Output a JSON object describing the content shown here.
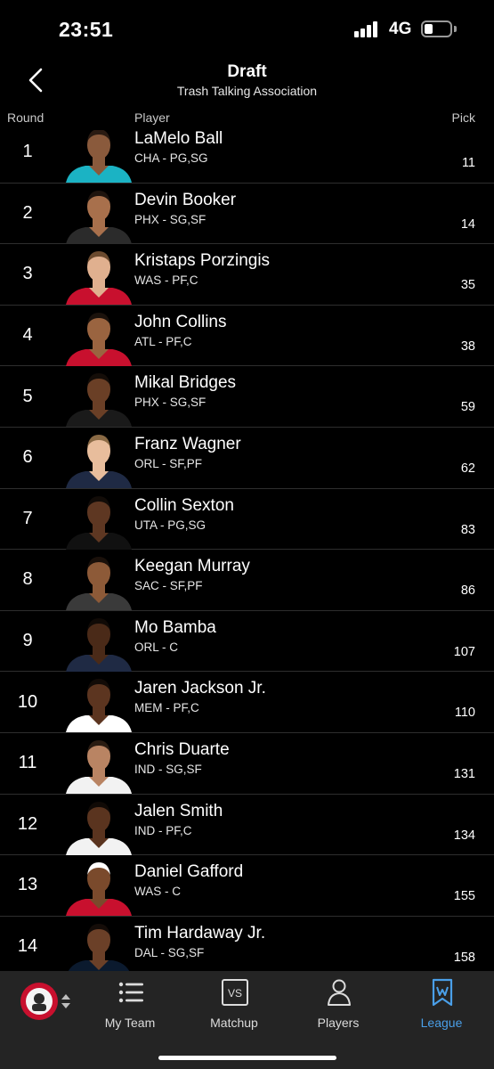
{
  "status": {
    "time": "23:51",
    "network": "4G"
  },
  "header": {
    "title": "Draft",
    "subtitle": "Trash Talking Association"
  },
  "columns": {
    "round": "Round",
    "player": "Player",
    "pick": "Pick"
  },
  "picks": [
    {
      "round": "1",
      "name": "LaMelo Ball",
      "info": "CHA - PG,SG",
      "pick": "11",
      "jersey": "#1bb3c4",
      "skin": "#8a5a3c",
      "hair": "#2a1b12"
    },
    {
      "round": "2",
      "name": "Devin Booker",
      "info": "PHX - SG,SF",
      "pick": "14",
      "jersey": "#2b2b2b",
      "skin": "#a8704c",
      "hair": "#1e140e"
    },
    {
      "round": "3",
      "name": "Kristaps Porzingis",
      "info": "WAS - PF,C",
      "pick": "35",
      "jersey": "#c8102e",
      "skin": "#e0b08f",
      "hair": "#6b4a2e"
    },
    {
      "round": "4",
      "name": "John Collins",
      "info": "ATL - PF,C",
      "pick": "38",
      "jersey": "#c8102e",
      "skin": "#9a6440",
      "hair": "#1b120c"
    },
    {
      "round": "5",
      "name": "Mikal Bridges",
      "info": "PHX - SG,SF",
      "pick": "59",
      "jersey": "#1a1a1a",
      "skin": "#6a3f26",
      "hair": "#140d08"
    },
    {
      "round": "6",
      "name": "Franz Wagner",
      "info": "ORL - SF,PF",
      "pick": "62",
      "jersey": "#1f2a44",
      "skin": "#e8bd9c",
      "hair": "#8a6a45"
    },
    {
      "round": "7",
      "name": "Collin Sexton",
      "info": "UTA - PG,SG",
      "pick": "83",
      "jersey": "#111111",
      "skin": "#5e3722",
      "hair": "#120c08"
    },
    {
      "round": "8",
      "name": "Keegan Murray",
      "info": "SAC - SF,PF",
      "pick": "86",
      "jersey": "#3a3a3a",
      "skin": "#8d5a38",
      "hair": "#1a100a"
    },
    {
      "round": "9",
      "name": "Mo Bamba",
      "info": "ORL - C",
      "pick": "107",
      "jersey": "#1f2a44",
      "skin": "#4a2a18",
      "hair": "#100a06"
    },
    {
      "round": "10",
      "name": "Jaren Jackson Jr.",
      "info": "MEM - PF,C",
      "pick": "110",
      "jersey": "#ffffff",
      "skin": "#5c3520",
      "hair": "#120b07"
    },
    {
      "round": "11",
      "name": "Chris Duarte",
      "info": "IND - SG,SF",
      "pick": "131",
      "jersey": "#f2f2f2",
      "skin": "#b98463",
      "hair": "#2a1c12"
    },
    {
      "round": "12",
      "name": "Jalen Smith",
      "info": "IND - PF,C",
      "pick": "134",
      "jersey": "#f2f2f2",
      "skin": "#5a341f",
      "hair": "#100a06"
    },
    {
      "round": "13",
      "name": "Daniel Gafford",
      "info": "WAS - C",
      "pick": "155",
      "jersey": "#c8102e",
      "skin": "#7a4a2c",
      "hair": "#ffffff"
    },
    {
      "round": "14",
      "name": "Tim Hardaway Jr.",
      "info": "DAL - SG,SF",
      "pick": "158",
      "jersey": "#0b1a2e",
      "skin": "#6b4028",
      "hair": "#140c08"
    }
  ],
  "tabs": [
    {
      "label": "My Team",
      "icon": "list-icon"
    },
    {
      "label": "Matchup",
      "icon": "vs-icon",
      "icon_text": "VS"
    },
    {
      "label": "Players",
      "icon": "person-icon"
    },
    {
      "label": "League",
      "icon": "bookmark-icon",
      "active": true
    }
  ],
  "colors": {
    "accent": "#4a9fe8",
    "background": "#000000",
    "tabbar": "#242424",
    "divider": "#2e2e2e"
  }
}
